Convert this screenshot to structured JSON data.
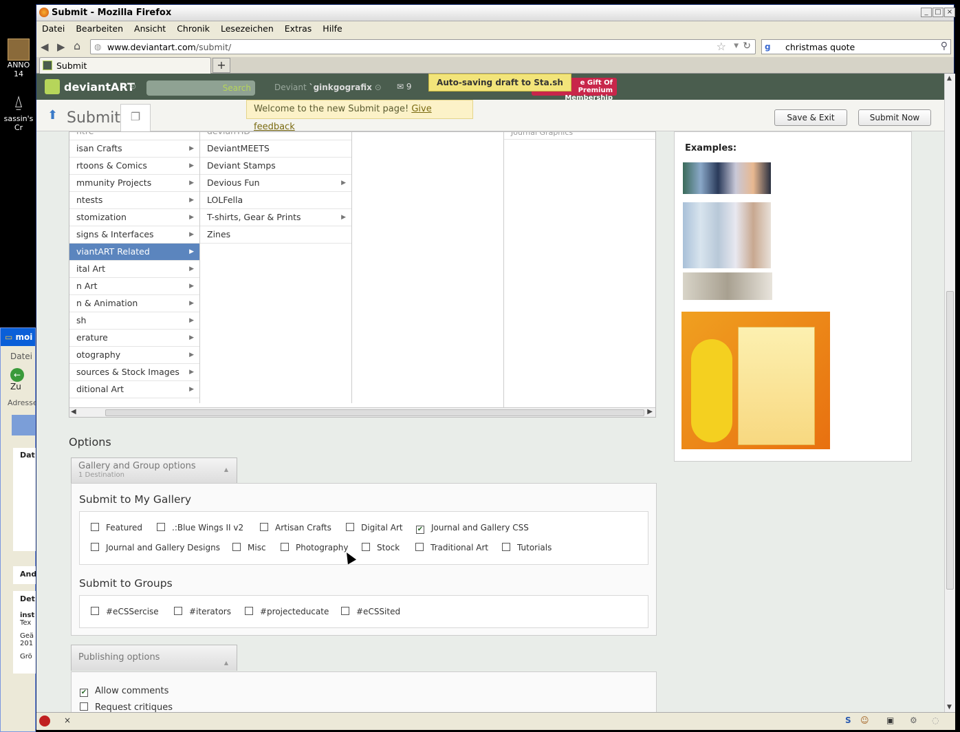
{
  "window": {
    "title": "Submit - Mozilla Firefox",
    "tab_title": "Submit",
    "url_host": "www.deviantart.com",
    "url_path": "/submit/",
    "search_value": "christmas quote"
  },
  "menu": [
    "Datei",
    "Bearbeiten",
    "Ansicht",
    "Chronik",
    "Lesezeichen",
    "Extras",
    "Hilfe"
  ],
  "desktop": {
    "icon1": "ANNO 14",
    "icon2": "sassin's Cr"
  },
  "bgwindow": {
    "title": "moi",
    "menu": "Datei",
    "back": "Zu",
    "addr": "Adresse",
    "d1": "Dat",
    "d2": "And",
    "d3": "Det",
    "d4": "inst",
    "d5": "Tex",
    "d6": "Geä",
    "d7": "201",
    "d8": "Grö"
  },
  "da": {
    "logo": "deviantART",
    "search_btn": "Search",
    "deviant_label": "Deviant",
    "username": "`ginkgografix",
    "msg_count": "9",
    "autosave": "Auto-saving draft to Sta.sh",
    "gift1": "e Gift Of",
    "gift2": "Premium Membership"
  },
  "submit": {
    "title": "Submit",
    "welcome": "Welcome to the new Submit page!",
    "feedback": "Give feedback",
    "save_exit": "Save & Exit",
    "submit_now": "Submit Now"
  },
  "cat_col1": [
    {
      "label": "isan Crafts"
    },
    {
      "label": "rtoons & Comics"
    },
    {
      "label": "mmunity Projects"
    },
    {
      "label": "ntests"
    },
    {
      "label": "stomization"
    },
    {
      "label": "signs & Interfaces"
    },
    {
      "label": "viantART Related",
      "selected": true
    },
    {
      "label": "ital Art"
    },
    {
      "label": "n Art"
    },
    {
      "label": "n & Animation"
    },
    {
      "label": "sh"
    },
    {
      "label": "erature"
    },
    {
      "label": "otography"
    },
    {
      "label": "sources & Stock Images"
    },
    {
      "label": "ditional Art"
    }
  ],
  "cat_col2": [
    {
      "label": "DeviantMEETS",
      "arrow": false
    },
    {
      "label": "Deviant Stamps",
      "arrow": false
    },
    {
      "label": "Devious Fun",
      "arrow": true
    },
    {
      "label": "LOLFella",
      "arrow": false
    },
    {
      "label": "T-shirts, Gear & Prints",
      "arrow": true
    },
    {
      "label": "Zines",
      "arrow": false
    }
  ],
  "col1_partial_top": "ntre",
  "col2_partial_top": "devianTID",
  "col4_partial_top": "Journal Graphics",
  "examples_label": "Examples:",
  "options": {
    "heading": "Options",
    "gallery_acc_title": "Gallery and Group options",
    "gallery_acc_sub": "1 Destination",
    "my_gallery_h": "Submit to My Gallery",
    "gallery_row1": [
      {
        "label": "Featured",
        "checked": false
      },
      {
        "label": ".:Blue Wings II v2",
        "checked": false
      },
      {
        "label": "Artisan Crafts",
        "checked": false
      },
      {
        "label": "Digital Art",
        "checked": false
      },
      {
        "label": "Journal and Gallery CSS",
        "checked": true
      }
    ],
    "gallery_row2": [
      {
        "label": "Journal and Gallery Designs",
        "checked": false
      },
      {
        "label": "Misc",
        "checked": false
      },
      {
        "label": "Photography",
        "checked": false
      },
      {
        "label": "Stock",
        "checked": false
      },
      {
        "label": "Traditional Art",
        "checked": false
      },
      {
        "label": "Tutorials",
        "checked": false
      }
    ],
    "groups_h": "Submit to Groups",
    "groups": [
      {
        "label": "#eCSSercise"
      },
      {
        "label": "#iterators"
      },
      {
        "label": "#projecteducate"
      },
      {
        "label": "#eCSSited"
      }
    ],
    "publishing_acc_title": "Publishing options",
    "allow_comments": "Allow comments",
    "request_critiques": "Request critiques"
  },
  "colors": {
    "da_header": "#4a5d4e",
    "selected": "#5b85be",
    "search_green": "#b6d55a"
  }
}
